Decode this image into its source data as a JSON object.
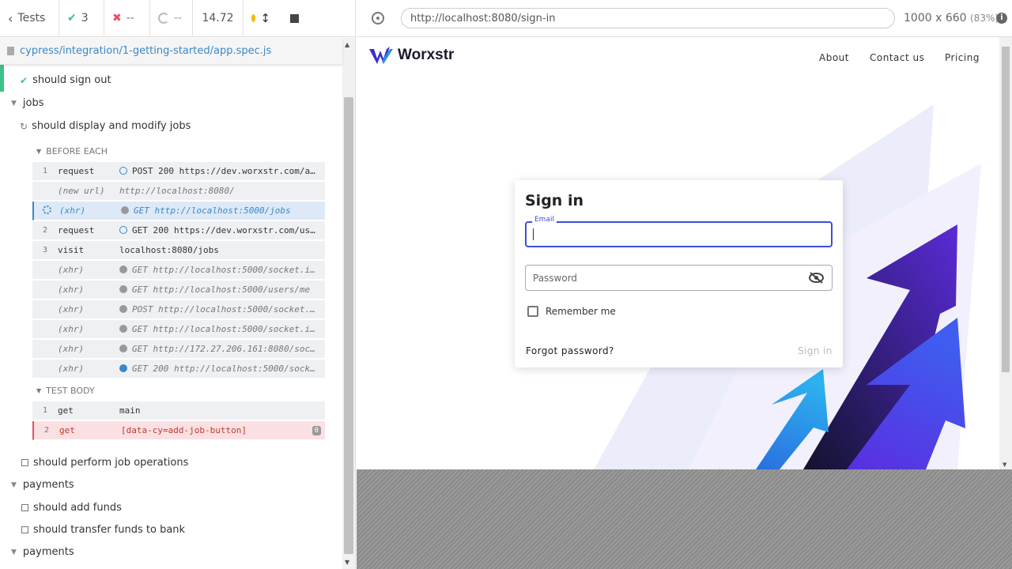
{
  "runner": {
    "back_label": "Tests",
    "passed": "3",
    "failed": "--",
    "pending": "--",
    "duration": "14.72",
    "spec_path": "cypress/integration/1-getting-started/app.spec.js",
    "colors": {
      "pass": "#3cc28a",
      "fail": "#e94f5f",
      "accent": "#3b87c7"
    }
  },
  "reporter": {
    "test_sign_out": "should sign out",
    "suite_jobs": "jobs",
    "test_jobs": "should display and modify jobs",
    "hook_before": "BEFORE EACH",
    "hook_body": "TEST BODY",
    "before_commands": [
      {
        "num": "1",
        "name": "request",
        "msg": "POST 200 https://dev.worxstr.com/a...",
        "dot": "o",
        "kind": "cmd"
      },
      {
        "num": "",
        "name": "(new url)",
        "msg": "http://localhost:8080/",
        "dot": "",
        "kind": "xhr"
      },
      {
        "num": "",
        "name": "(xhr)",
        "msg": "GET http://localhost:5000/jobs",
        "dot": "g",
        "kind": "xhr",
        "active": true
      },
      {
        "num": "2",
        "name": "request",
        "msg": "GET 200 https://dev.worxstr.com/us...",
        "dot": "o",
        "kind": "cmd"
      },
      {
        "num": "3",
        "name": "visit",
        "msg": "localhost:8080/jobs",
        "dot": "",
        "kind": "cmd"
      },
      {
        "num": "",
        "name": "(xhr)",
        "msg": "GET http://localhost:5000/socket.i...",
        "dot": "g",
        "kind": "xhr"
      },
      {
        "num": "",
        "name": "(xhr)",
        "msg": "GET http://localhost:5000/users/me",
        "dot": "g",
        "kind": "xhr"
      },
      {
        "num": "",
        "name": "(xhr)",
        "msg": "POST http://localhost:5000/socket....",
        "dot": "g",
        "kind": "xhr"
      },
      {
        "num": "",
        "name": "(xhr)",
        "msg": "GET http://localhost:5000/socket.i...",
        "dot": "g",
        "kind": "xhr"
      },
      {
        "num": "",
        "name": "(xhr)",
        "msg": "GET http://172.27.206.161:8080/soc...",
        "dot": "g",
        "kind": "xhr"
      },
      {
        "num": "",
        "name": "(xhr)",
        "msg": "GET 200 http://localhost:5000/sock...",
        "dot": "b",
        "kind": "xhr"
      }
    ],
    "body_commands": [
      {
        "num": "1",
        "name": "get",
        "msg": "main"
      },
      {
        "num": "2",
        "name": "get",
        "msg": "[data-cy=add-job-button]",
        "badge": "0"
      }
    ],
    "test_job_ops": "should perform job operations",
    "suite_payments": "payments",
    "test_add_funds": "should add funds",
    "test_transfer": "should transfer funds to bank",
    "suite_payments2": "payments"
  },
  "browser": {
    "url": "http://localhost:8080/sign-in",
    "viewport": "1000 x 660",
    "zoom": "(83%)"
  },
  "app": {
    "brand": "Worxstr",
    "nav": [
      "About",
      "Contact us",
      "Pricing"
    ],
    "signin_title": "Sign in",
    "email_label": "Email",
    "email_value": "",
    "password_placeholder": "Password",
    "remember_label": "Remember me",
    "forgot_label": "Forgot password?",
    "signin_button": "Sign in",
    "colors": {
      "primary": "#3b4fd8",
      "arrow_purple": "#5b2bd6",
      "arrow_blue": "#2f8de4"
    }
  }
}
